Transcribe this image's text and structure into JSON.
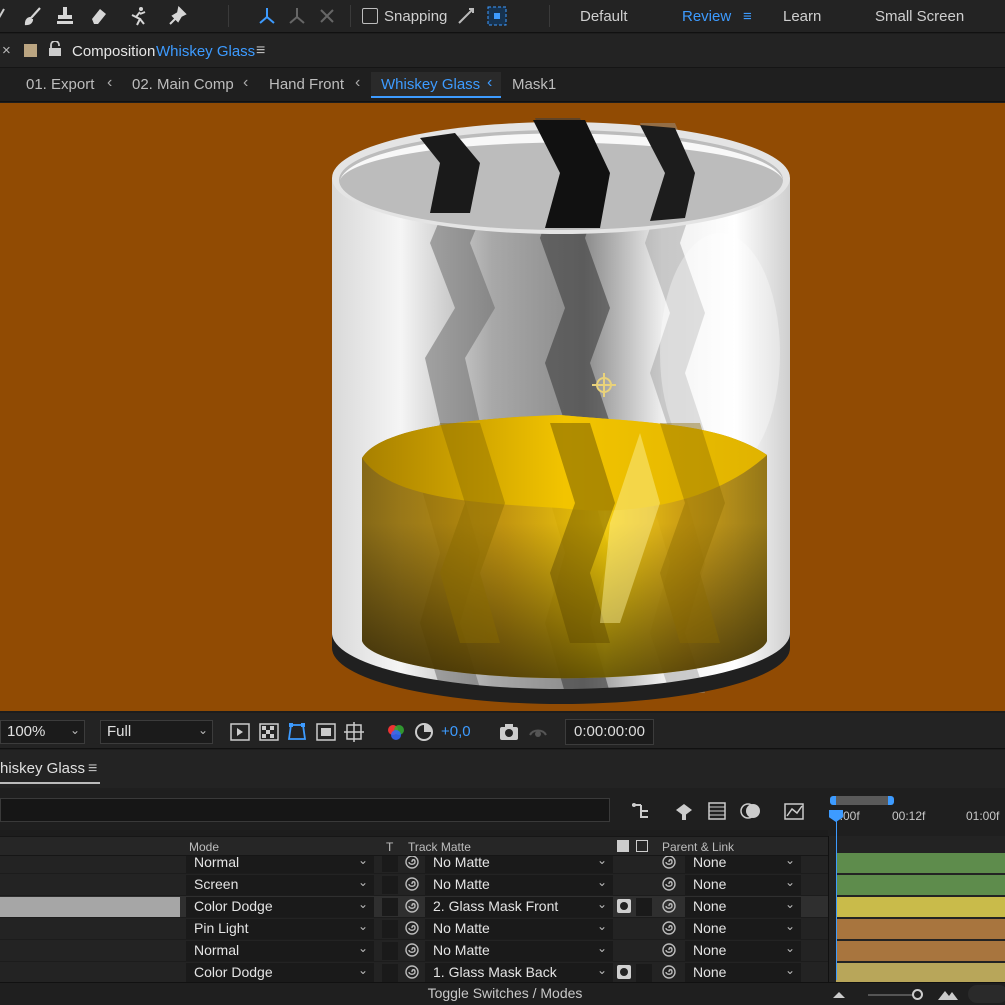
{
  "toolbar": {
    "snapping_label": "Snapping",
    "workspaces": [
      "Default",
      "Review",
      "Learn",
      "Small Screen"
    ],
    "active_workspace": "Review",
    "tools": [
      "brush-icon",
      "clone-stamp-icon",
      "eraser-icon",
      "puppet-icon",
      "pin-icon"
    ]
  },
  "composition": {
    "close": "×",
    "word": "Composition",
    "name": "Whiskey Glass",
    "menu": "≡"
  },
  "breadcrumbs": [
    "01. Export",
    "02. Main Comp",
    "Hand Front",
    "Whiskey Glass",
    "Mask1"
  ],
  "viewer": {
    "background_color": "#914b03",
    "zoom": "100%",
    "resolution": "Full",
    "exposure": "+0,0",
    "timecode": "0:00:00:00"
  },
  "timeline": {
    "tab_label": "hiskey Glass",
    "columns": {
      "mode": "Mode",
      "t": "T",
      "track_matte": "Track Matte",
      "parent": "Parent & Link"
    },
    "rows": [
      {
        "mode": "Normal",
        "matte": "No Matte",
        "parent": "None",
        "matte_icon": false,
        "selected": false,
        "bar_color": "#5e8c4c"
      },
      {
        "mode": "Screen",
        "matte": "No Matte",
        "parent": "None",
        "matte_icon": false,
        "selected": false,
        "bar_color": "#5e8c4c"
      },
      {
        "mode": "Color Dodge",
        "matte": "2. Glass Mask Front",
        "parent": "None",
        "matte_icon": true,
        "selected": true,
        "bar_color": "#c9bb4a"
      },
      {
        "mode": "Pin Light",
        "matte": "No Matte",
        "parent": "None",
        "matte_icon": false,
        "selected": false,
        "bar_color": "#a8753e"
      },
      {
        "mode": "Normal",
        "matte": "No Matte",
        "parent": "None",
        "matte_icon": false,
        "selected": false,
        "bar_color": "#a8753e"
      },
      {
        "mode": "Color Dodge",
        "matte": "1. Glass Mask Back",
        "parent": "None",
        "matte_icon": true,
        "selected": false,
        "bar_color": "#b8a65a"
      }
    ],
    "ruler": [
      "0:00f",
      "00:12f",
      "01:00f"
    ],
    "footer_label": "Toggle Switches / Modes"
  }
}
